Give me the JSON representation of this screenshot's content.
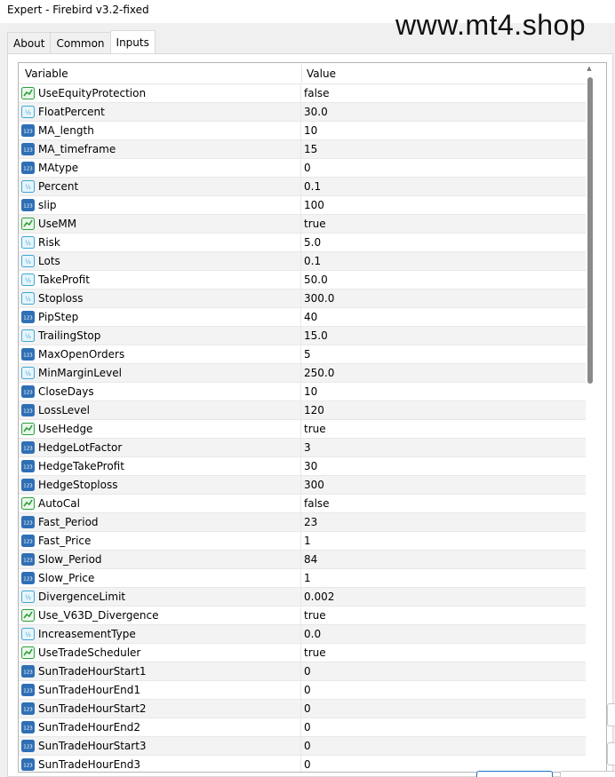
{
  "window": {
    "title": "Expert - Firebird v3.2-fixed"
  },
  "watermark": "www.mt4.shop",
  "tabs": [
    {
      "label": "About"
    },
    {
      "label": "Common"
    },
    {
      "label": "Inputs",
      "active": true
    }
  ],
  "grid": {
    "columns": {
      "variable": "Variable",
      "value": "Value"
    },
    "rows": [
      {
        "name": "UseEquityProtection",
        "value": "false",
        "type": "bool",
        "icon": "bool-icon"
      },
      {
        "name": "FloatPercent",
        "value": "30.0",
        "type": "double",
        "icon": "double-icon"
      },
      {
        "name": "MA_length",
        "value": "10",
        "type": "int",
        "icon": "int-icon"
      },
      {
        "name": "MA_timeframe",
        "value": "15",
        "type": "int",
        "icon": "int-icon"
      },
      {
        "name": "MAtype",
        "value": "0",
        "type": "int",
        "icon": "int-icon"
      },
      {
        "name": "Percent",
        "value": "0.1",
        "type": "double",
        "icon": "double-icon"
      },
      {
        "name": "slip",
        "value": "100",
        "type": "int",
        "icon": "int-icon"
      },
      {
        "name": "UseMM",
        "value": "true",
        "type": "bool",
        "icon": "bool-icon"
      },
      {
        "name": "Risk",
        "value": "5.0",
        "type": "double",
        "icon": "double-icon"
      },
      {
        "name": "Lots",
        "value": "0.1",
        "type": "double",
        "icon": "double-icon"
      },
      {
        "name": "TakeProfit",
        "value": "50.0",
        "type": "double",
        "icon": "double-icon"
      },
      {
        "name": "Stoploss",
        "value": "300.0",
        "type": "double",
        "icon": "double-icon"
      },
      {
        "name": "PipStep",
        "value": "40",
        "type": "int",
        "icon": "int-icon"
      },
      {
        "name": "TrailingStop",
        "value": "15.0",
        "type": "double",
        "icon": "double-icon"
      },
      {
        "name": "MaxOpenOrders",
        "value": "5",
        "type": "int",
        "icon": "int-icon"
      },
      {
        "name": "MinMarginLevel",
        "value": "250.0",
        "type": "double",
        "icon": "double-icon"
      },
      {
        "name": "CloseDays",
        "value": "10",
        "type": "int",
        "icon": "int-icon"
      },
      {
        "name": "LossLevel",
        "value": "120",
        "type": "int",
        "icon": "int-icon"
      },
      {
        "name": "UseHedge",
        "value": "true",
        "type": "bool",
        "icon": "bool-icon"
      },
      {
        "name": "HedgeLotFactor",
        "value": "3",
        "type": "int",
        "icon": "int-icon"
      },
      {
        "name": "HedgeTakeProfit",
        "value": "30",
        "type": "int",
        "icon": "int-icon"
      },
      {
        "name": "HedgeStoploss",
        "value": "300",
        "type": "int",
        "icon": "int-icon"
      },
      {
        "name": "AutoCal",
        "value": "false",
        "type": "bool",
        "icon": "bool-icon"
      },
      {
        "name": "Fast_Period",
        "value": "23",
        "type": "int",
        "icon": "int-icon"
      },
      {
        "name": "Fast_Price",
        "value": "1",
        "type": "int",
        "icon": "int-icon"
      },
      {
        "name": "Slow_Period",
        "value": "84",
        "type": "int",
        "icon": "int-icon"
      },
      {
        "name": "Slow_Price",
        "value": "1",
        "type": "int",
        "icon": "int-icon"
      },
      {
        "name": "DivergenceLimit",
        "value": "0.002",
        "type": "double",
        "icon": "double-icon"
      },
      {
        "name": "Use_V63D_Divergence",
        "value": "true",
        "type": "bool",
        "icon": "bool-icon"
      },
      {
        "name": "IncreasementType",
        "value": "0.0",
        "type": "double",
        "icon": "double-icon"
      },
      {
        "name": "UseTradeScheduler",
        "value": "true",
        "type": "bool",
        "icon": "bool-icon"
      },
      {
        "name": "SunTradeHourStart1",
        "value": "0",
        "type": "int",
        "icon": "int-icon"
      },
      {
        "name": "SunTradeHourEnd1",
        "value": "0",
        "type": "int",
        "icon": "int-icon"
      },
      {
        "name": "SunTradeHourStart2",
        "value": "0",
        "type": "int",
        "icon": "int-icon"
      },
      {
        "name": "SunTradeHourEnd2",
        "value": "0",
        "type": "int",
        "icon": "int-icon"
      },
      {
        "name": "SunTradeHourStart3",
        "value": "0",
        "type": "int",
        "icon": "int-icon"
      },
      {
        "name": "SunTradeHourEnd3",
        "value": "0",
        "type": "int",
        "icon": "int-icon"
      }
    ]
  },
  "colors": {
    "bool_icon": "#2e9e3a",
    "double_icon": "#3fa7d6",
    "int_icon": "#2f6fb5",
    "scroll_thumb": "#8a8a8a",
    "primary_button_border": "#1e6fd0"
  }
}
